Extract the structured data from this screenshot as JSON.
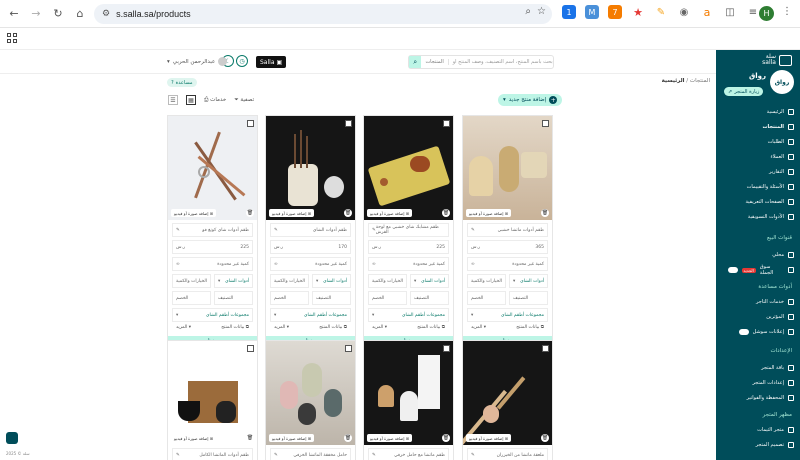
{
  "browser": {
    "url": "s.salla.sa/products",
    "ext_badge_1": "1",
    "ext_badge_2": "7",
    "profile_initial": "H"
  },
  "header": {
    "search_placeholder": "ابحث باسم المنتج، اسم التصنيف، وصف المنتج أو SKU",
    "search_scope": "المنتجات",
    "salla_label": "Salla",
    "user_name": "عبدالرحمن الحربي"
  },
  "sidebar": {
    "brand": "سلة",
    "brand_sub": "salla",
    "store_name": "رواق",
    "store_sub": "باقة بلس",
    "store_logo": "رواق",
    "visit_store": "زيارة المتجر",
    "items": [
      {
        "label": "الرئيسية"
      },
      {
        "label": "المنتجات"
      },
      {
        "label": "الطلبات"
      },
      {
        "label": "العملاء"
      },
      {
        "label": "التقارير"
      },
      {
        "label": "الأسئلة والتقييمات"
      },
      {
        "label": "الصفحات التعريفية"
      },
      {
        "label": "الأدوات التسويقية"
      }
    ],
    "section_sales": "قنوات البيع",
    "sales_items": [
      {
        "label": "محلي"
      },
      {
        "label": "سوق الجملة"
      }
    ],
    "new_badge": "الجديد",
    "section_services": "أدوات مساعدة",
    "service_items": [
      {
        "label": "خدمات التاجر"
      },
      {
        "label": "المؤثرين"
      },
      {
        "label": "إعلانات سوشل"
      }
    ],
    "section_settings": "الإعدادات",
    "settings_items": [
      {
        "label": "باقة المتجر"
      },
      {
        "label": "إعدادات المتجر"
      },
      {
        "label": "المحفظة والفواتير"
      }
    ],
    "section_design": "مظهر المتجر",
    "design_items": [
      {
        "label": "متجر الثيمات"
      },
      {
        "label": "تصميم المتجر"
      }
    ]
  },
  "page": {
    "breadcrumb_home": "الرئيسية",
    "breadcrumb_current": "المنتجات",
    "help": "مساعدة",
    "add_product": "إضافة منتج جديد",
    "filter": "تصفية",
    "services": "خدمات"
  },
  "card_labels": {
    "add_image": "إضافة صورة أو فيديو",
    "price_unit": "ر.س",
    "qty_unlimited": "كمية غير محدودة",
    "options": "الخيارات والكمية",
    "category": "أدوات الشاي",
    "discount": "الخصم",
    "more": "المزيد",
    "product_data": "بيانات المنتج",
    "save": "حفظ",
    "category_label": "التصنيف",
    "collections_label": "مجموعات أطقم الشاي"
  },
  "products": [
    {
      "name": "طقم أدوات ماتشا خشبي",
      "price": "365"
    },
    {
      "name": "طقم مشابك شاي خشبي مع لوحة الفرش",
      "price": "225"
    },
    {
      "name": "طقم أدوات الشاي",
      "price": "170"
    },
    {
      "name": "طقم أدوات شاي كونغ فو",
      "price": "225"
    }
  ],
  "products_row2": [
    {
      "name": "ملعقة ماتشا من الخيزران"
    },
    {
      "name": "طقم ماتشا مع حامل خزفي"
    },
    {
      "name": "حامل مخفقة الماتشا الخزفي"
    },
    {
      "name": "طقم أدوات الماتشا الكامل"
    }
  ],
  "footer": {
    "version": "2025 © سلة"
  }
}
